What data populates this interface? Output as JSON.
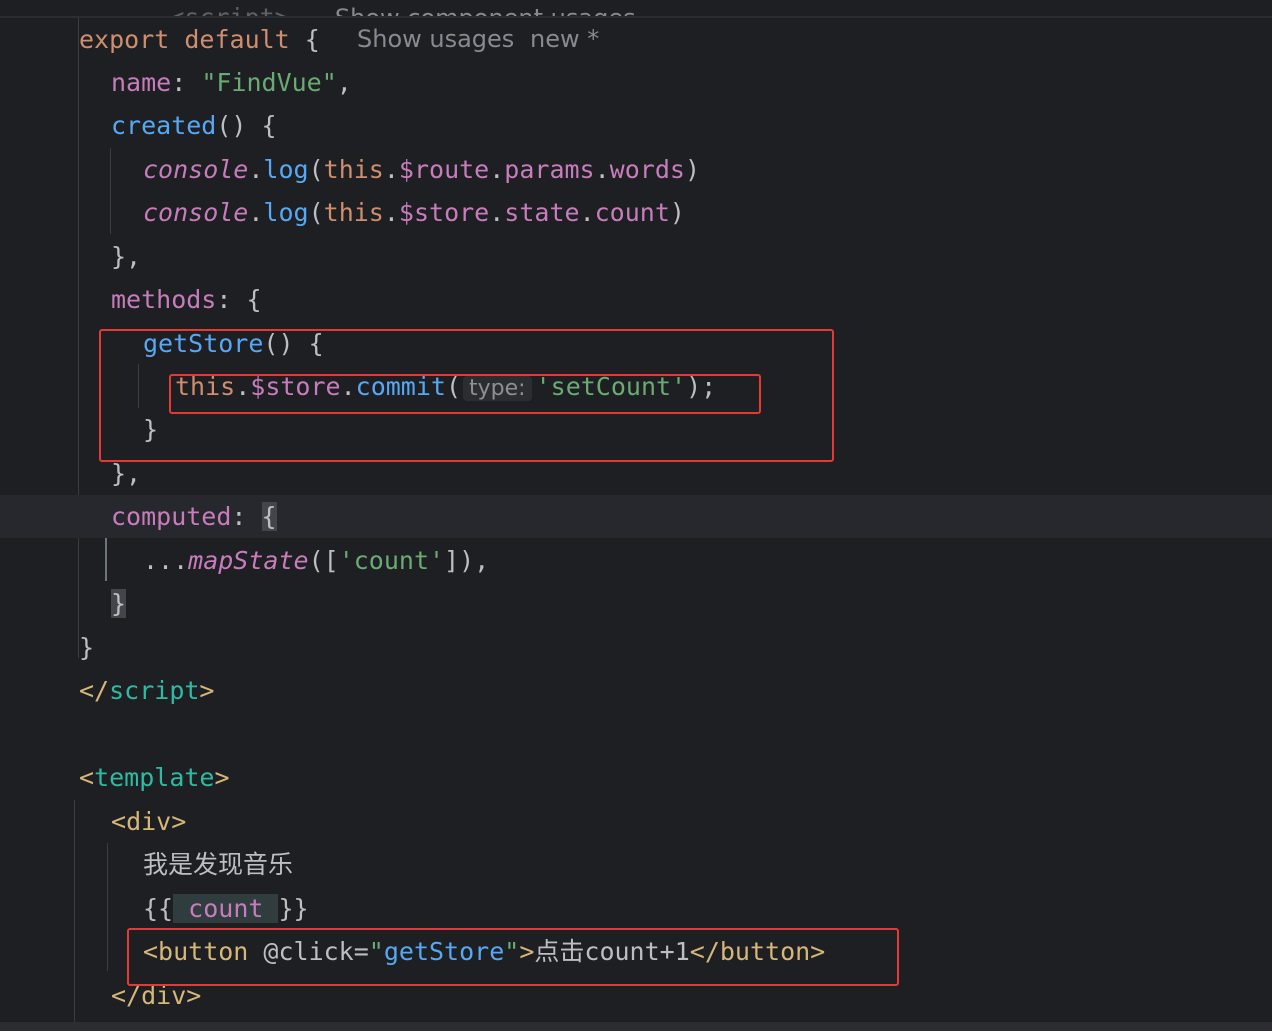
{
  "editor": {
    "top_line": {
      "tag_open": "<script>",
      "hint": "Show component usages"
    },
    "export_hint_usages": "Show usages",
    "export_hint_new": "new *",
    "inlay_type": "type:",
    "lines": {
      "l1_export": "export",
      "l1_default": "default",
      "l1_brace": "{",
      "l2_name": "name",
      "l2_colon": ": ",
      "l2_value": "\"FindVue\"",
      "l2_comma": ",",
      "l3_created": "created",
      "l3_rest": "() {",
      "l4_console": "console",
      "l4_dot1": ".",
      "l4_log": "log",
      "l4_paren": "(",
      "l4_this": "this",
      "l4_dot2": ".",
      "l4_route": "$route",
      "l4_dot3": ".",
      "l4_params": "params",
      "l4_dot4": ".",
      "l4_words": "words",
      "l4_close": ")",
      "l5_console": "console",
      "l5_dot1": ".",
      "l5_log": "log",
      "l5_paren": "(",
      "l5_this": "this",
      "l5_dot2": ".",
      "l5_store": "$store",
      "l5_dot3": ".",
      "l5_state": "state",
      "l5_dot4": ".",
      "l5_count": "count",
      "l5_close": ")",
      "l6": "},",
      "l7_methods": "methods",
      "l7_rest": ": {",
      "l8_getStore": "getStore",
      "l8_rest": "() {",
      "l9_this": "this",
      "l9_dot1": ".",
      "l9_store": "$store",
      "l9_dot2": ".",
      "l9_commit": "commit",
      "l9_paren": "(",
      "l9_arg": "'setCount'",
      "l9_close": ");",
      "l10": "}",
      "l11": "},",
      "l12_computed": "computed",
      "l12_colon": ": ",
      "l12_brace": "{",
      "l13_spread": "...",
      "l13_mapState": "mapState",
      "l13_open": "([",
      "l13_arg": "'count'",
      "l13_close": "]),",
      "l14_brace": "}",
      "l15": "}",
      "l16_open": "</",
      "l16_tag": "script",
      "l16_close": ">",
      "l18_open": "<",
      "l18_tag": "template",
      "l18_close": ">",
      "l19_open": "<",
      "l19_tag": "div",
      "l19_close": ">",
      "l20_text": "我是发现音乐",
      "l21_open": "{{",
      "l21_count": " count ",
      "l21_close": "}}",
      "l22_open": "<button",
      "l22_attr": " @click",
      "l22_eq": "=",
      "l22_q1": "\"",
      "l22_handler": "getStore",
      "l22_q2": "\"",
      "l22_gt": ">",
      "l22_text_cjk": "点击",
      "l22_text": "count+1",
      "l22_end": "</button>",
      "l23_open": "</",
      "l23_tag": "div",
      "l23_close": ">"
    }
  },
  "colors": {
    "background": "#1e1f22",
    "keyword": "#cf8e6d",
    "property": "#c77dbb",
    "function": "#56a8f5",
    "string": "#6aab73",
    "tag": "#d5b778",
    "annotation_box": "#e53935"
  }
}
